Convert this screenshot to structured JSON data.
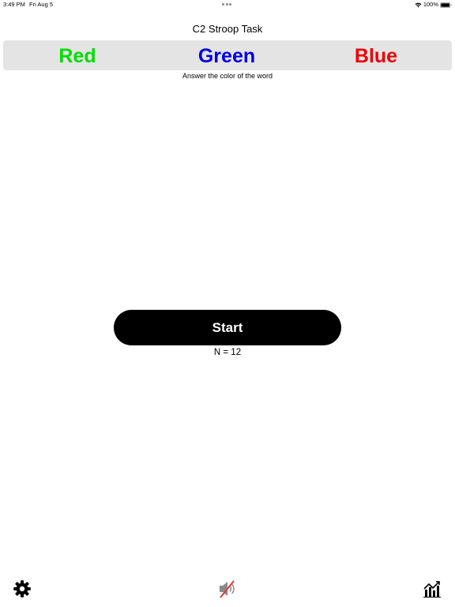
{
  "status_bar": {
    "time": "3:49 PM",
    "date": "Fri Aug 5",
    "battery": "100%"
  },
  "header": {
    "title": "C2 Stroop Task"
  },
  "answers": [
    {
      "label": "Red",
      "color": "#00dd00"
    },
    {
      "label": "Green",
      "color": "#0000e0"
    },
    {
      "label": "Blue",
      "color": "#ee0000"
    }
  ],
  "instruction": "Answer the color of the word",
  "start_button": {
    "label": "Start"
  },
  "trial_count": "N = 12",
  "toolbar": {
    "icons": [
      "gear-icon",
      "speaker-muted-icon",
      "chart-icon"
    ]
  },
  "colors": {
    "answer_bar_bg": "#e4e4e4",
    "start_bg": "#000000",
    "mute_slash": "#e53935"
  }
}
